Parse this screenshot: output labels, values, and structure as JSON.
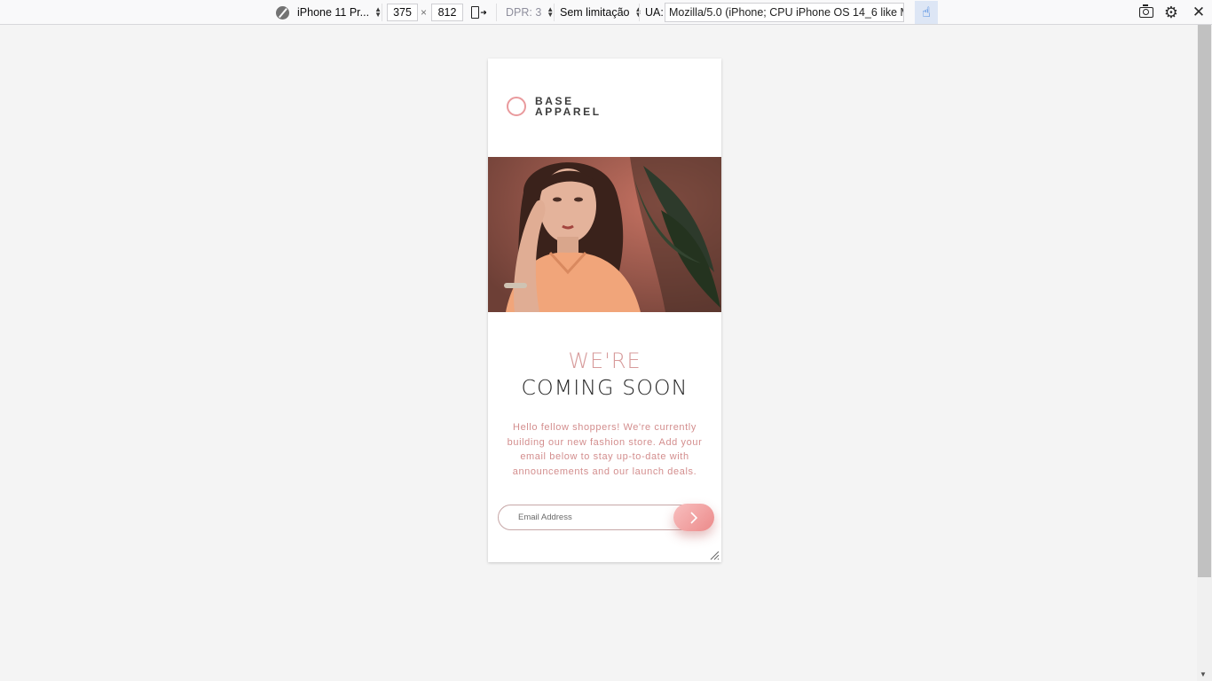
{
  "toolbar": {
    "device_name": "iPhone 11 Pr...",
    "width": "375",
    "height": "812",
    "times": "×",
    "dpr": "DPR: 3",
    "throttling": "Sem limitação",
    "ua_label": "UA:",
    "user_agent": "Mozilla/5.0 (iPhone; CPU iPhone OS 14_6 like Mac"
  },
  "page": {
    "logo_line1": "BASE",
    "logo_line2": "APPAREL",
    "heading_accent": "WE'RE",
    "heading_main": "COMING SOON",
    "intro": "Hello fellow shoppers! We're currently building our new fashion store. Add your email below to stay up-to-date with announcements and our launch deals.",
    "email_placeholder": "Email Address"
  },
  "colors": {
    "accent": "#e99a9d",
    "heading_accent": "#d79b9b",
    "body_text": "#d38e8e",
    "button_gradient_start": "#f8bfbf",
    "button_gradient_end": "#ec8a8a"
  },
  "icons": {
    "device": "device-disabled-icon",
    "rotate": "rotate-viewport-icon",
    "touch": "touch-simulation-icon",
    "screenshot": "camera-icon",
    "settings": "gear-icon",
    "close": "close-icon",
    "submit": "chevron-right-icon"
  }
}
